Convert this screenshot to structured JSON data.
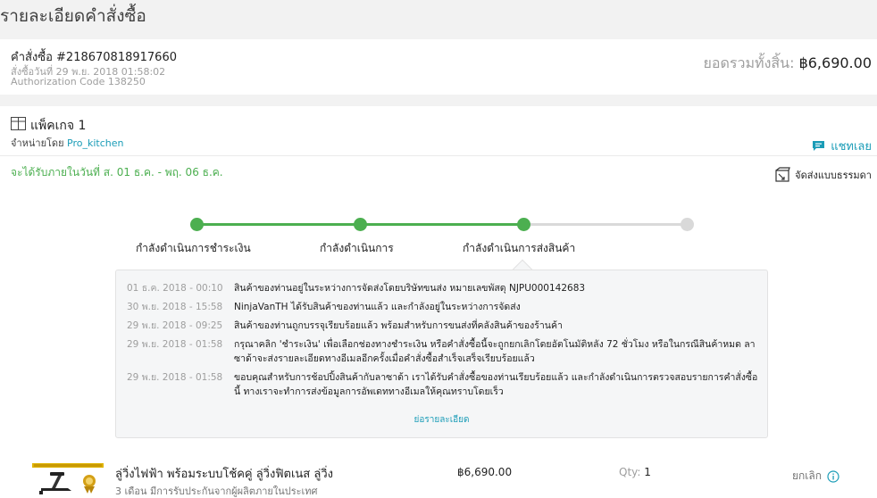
{
  "page": {
    "title": "รายละเอียดคำสั่งซื้อ"
  },
  "order": {
    "number": "คำสั่งซื้อ #218670818917660",
    "date": "สั่งซื้อวันที่ 29 พ.ย. 2018 01:58:02",
    "auth_code": "Authorization Code 138250",
    "total_label": "ยอดรวมทั้งสิ้น: ",
    "total_value": "฿6,690.00"
  },
  "package": {
    "title": "แพ็คเกจ 1",
    "seller_prefix": "จำหน่ายโดย ",
    "seller_name": "Pro_kitchen",
    "chat_label": "แชทเลย",
    "delivery_estimate": "จะได้รับภายในวันที่ ส. 01 ธ.ค. - พฤ. 06 ธ.ค.",
    "shipping_method": "จัดส่งแบบธรรมดา",
    "progress_fraction": 0.67,
    "steps": [
      {
        "label": "กำลังดำเนินการชำระเงิน"
      },
      {
        "label": "กำลังดำเนินการ"
      },
      {
        "label": "กำลังดำเนินการส่งสินค้า"
      },
      {
        "label": ""
      }
    ],
    "log": [
      {
        "time": "01 ธ.ค. 2018 - 00:10",
        "text": "สินค้าของท่านอยู่ในระหว่างการจัดส่งโดยบริษัทขนส่ง หมายเลขพัสดุ NJPU000142683"
      },
      {
        "time": "30 พ.ย. 2018 - 15:58",
        "text": "NinjaVanTH ได้รับสินค้าของท่านแล้ว และกำลังอยู่ในระหว่างการจัดส่ง"
      },
      {
        "time": "29 พ.ย. 2018 - 09:25",
        "text": "สินค้าของท่านถูกบรรจุเรียบร้อยแล้ว พร้อมสำหรับการขนส่งที่คลังสินค้าของร้านค้า"
      },
      {
        "time": "29 พ.ย. 2018 - 01:58",
        "text": "กรุณาคลิก 'ชำระเงิน' เพื่อเลือกช่องทางชำระเงิน หรือคำสั่งซื้อนี้จะถูกยกเลิกโดยอัตโนมัติหลัง 72 ชั่วโมง หรือในกรณีสินค้าหมด ลาซาด้าจะส่งรายละเอียดทางอีเมลอีกครั้งเมื่อคำสั่งซื้อสำเร็จเสร็จเรียบร้อยแล้ว"
      },
      {
        "time": "29 พ.ย. 2018 - 01:58",
        "text": "ขอบคุณสำหรับการช้อปปิ้งสินค้ากับลาซาด้า เราได้รับคำสั่งซื้อของท่านเรียบร้อยแล้ว และกำลังดำเนินการตรวจสอบรายการคำสั่งซื้อนี้ ทางเราจะทำการส่งข้อมูลการอัพเดททางอีเมลให้คุณทราบโดยเร็ว"
      }
    ],
    "log_toggle": "ย่อรายละเอียด"
  },
  "product": {
    "name": "ลู่วิ่งไฟฟ้า พร้อมระบบโช้คคู่ ลู่วิ่งฟิตเนส ลู่วิ่ง",
    "subtitle": "3 เดือน มีการรับประกันจากผู้ผลิตภายในประเทศ",
    "price": "฿6,690.00",
    "qty_label": "Qty: ",
    "qty_value": "1",
    "cancel_label": "ยกเลิก"
  },
  "colors": {
    "accent": "#1a9cb7",
    "progress": "#4caf50",
    "inactive": "#d9d9d9"
  }
}
